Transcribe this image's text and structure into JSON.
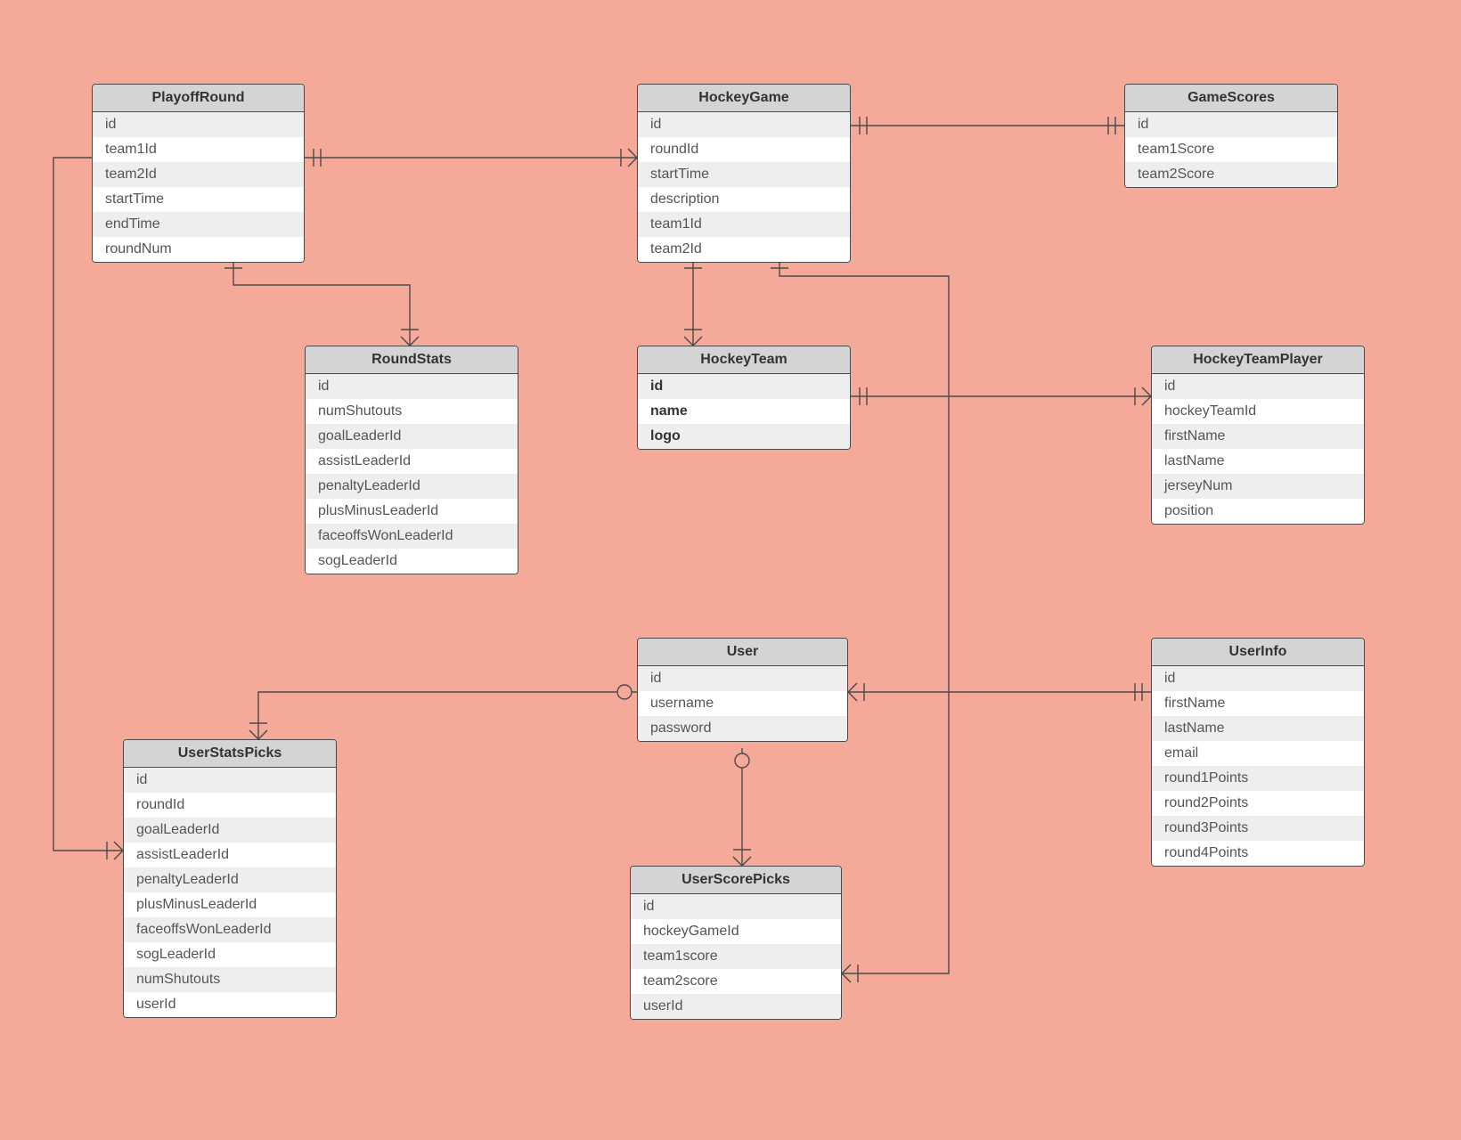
{
  "entities": {
    "playoffRound": {
      "title": "PlayoffRound",
      "rows": [
        "id",
        "team1Id",
        "team2Id",
        "startTime",
        "endTime",
        "roundNum"
      ]
    },
    "hockeyGame": {
      "title": "HockeyGame",
      "rows": [
        "id",
        "roundId",
        "startTime",
        "description",
        "team1Id",
        "team2Id"
      ]
    },
    "gameScores": {
      "title": "GameScores",
      "rows": [
        "id",
        "team1Score",
        "team2Score"
      ]
    },
    "roundStats": {
      "title": "RoundStats",
      "rows": [
        "id",
        "numShutouts",
        "goalLeaderId",
        "assistLeaderId",
        "penaltyLeaderId",
        "plusMinusLeaderId",
        "faceoffsWonLeaderId",
        "sogLeaderId"
      ]
    },
    "hockeyTeam": {
      "title": "HockeyTeam",
      "rows": [
        "id",
        "name",
        "logo"
      ],
      "bold": true
    },
    "hockeyTeamPlayer": {
      "title": "HockeyTeamPlayer",
      "rows": [
        "id",
        "hockeyTeamId",
        "firstName",
        "lastName",
        "jerseyNum",
        "position"
      ]
    },
    "user": {
      "title": "User",
      "rows": [
        "id",
        "username",
        "password"
      ]
    },
    "userInfo": {
      "title": "UserInfo",
      "rows": [
        "id",
        "firstName",
        "lastName",
        "email",
        "round1Points",
        "round2Points",
        "round3Points",
        "round4Points"
      ]
    },
    "userStatsPicks": {
      "title": "UserStatsPicks",
      "rows": [
        "id",
        "roundId",
        "goalLeaderId",
        "assistLeaderId",
        "penaltyLeaderId",
        "plusMinusLeaderId",
        "faceoffsWonLeaderId",
        "sogLeaderId",
        "numShutouts",
        "userId"
      ]
    },
    "userScorePicks": {
      "title": "UserScorePicks",
      "rows": [
        "id",
        "hockeyGameId",
        "team1score",
        "team2score",
        "userId"
      ]
    }
  }
}
